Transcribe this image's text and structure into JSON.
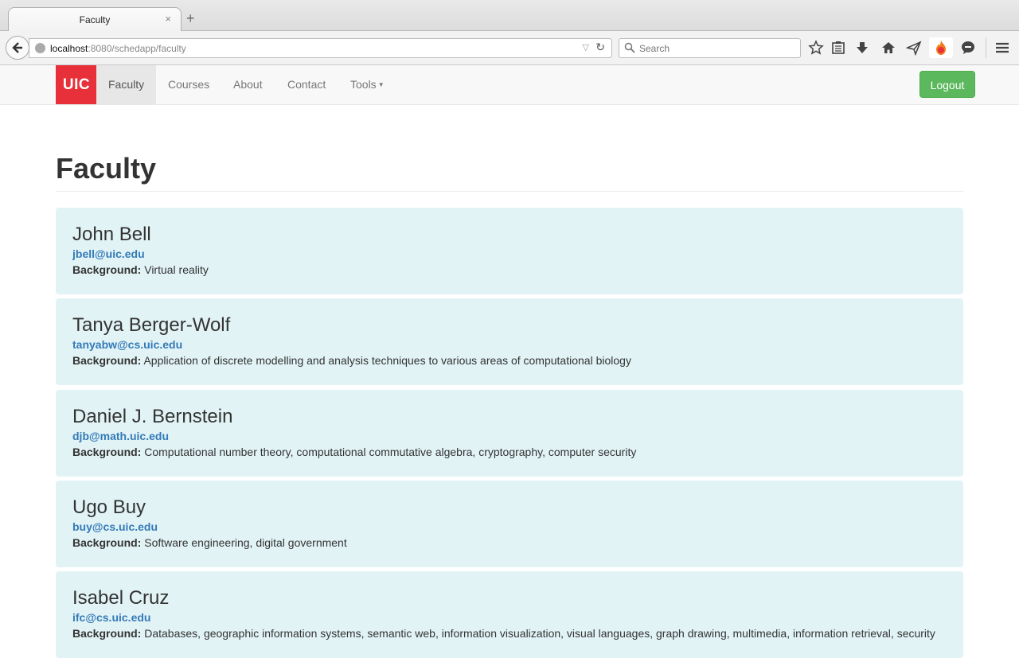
{
  "browser": {
    "tab_title": "Faculty",
    "tab_close": "×",
    "new_tab": "+",
    "url_host": "localhost",
    "url_rest": ":8080/schedapp/faculty",
    "search_placeholder": "Search"
  },
  "site": {
    "brand": "UIC",
    "nav": [
      "Faculty",
      "Courses",
      "About",
      "Contact",
      "Tools"
    ],
    "logout": "Logout"
  },
  "page": {
    "title": "Faculty",
    "background_label": "Background:"
  },
  "faculty": [
    {
      "name": "John Bell",
      "email": "jbell@uic.edu",
      "background": "Virtual reality"
    },
    {
      "name": "Tanya Berger-Wolf",
      "email": "tanyabw@cs.uic.edu",
      "background": "Application of discrete modelling and analysis techniques to various areas of computational biology"
    },
    {
      "name": "Daniel J. Bernstein",
      "email": "djb@math.uic.edu",
      "background": "Computational number theory, computational commutative algebra, cryptography, computer security"
    },
    {
      "name": "Ugo Buy",
      "email": "buy@cs.uic.edu",
      "background": "Software engineering, digital government"
    },
    {
      "name": "Isabel Cruz",
      "email": "ifc@cs.uic.edu",
      "background": "Databases, geographic information systems, semantic web, information visualization, visual languages, graph drawing, multimedia, information retrieval, security"
    }
  ],
  "colors": {
    "brand": "#e8303a",
    "card": "#e2f3f6",
    "link": "#337ab7",
    "logout": "#5cb85c"
  }
}
